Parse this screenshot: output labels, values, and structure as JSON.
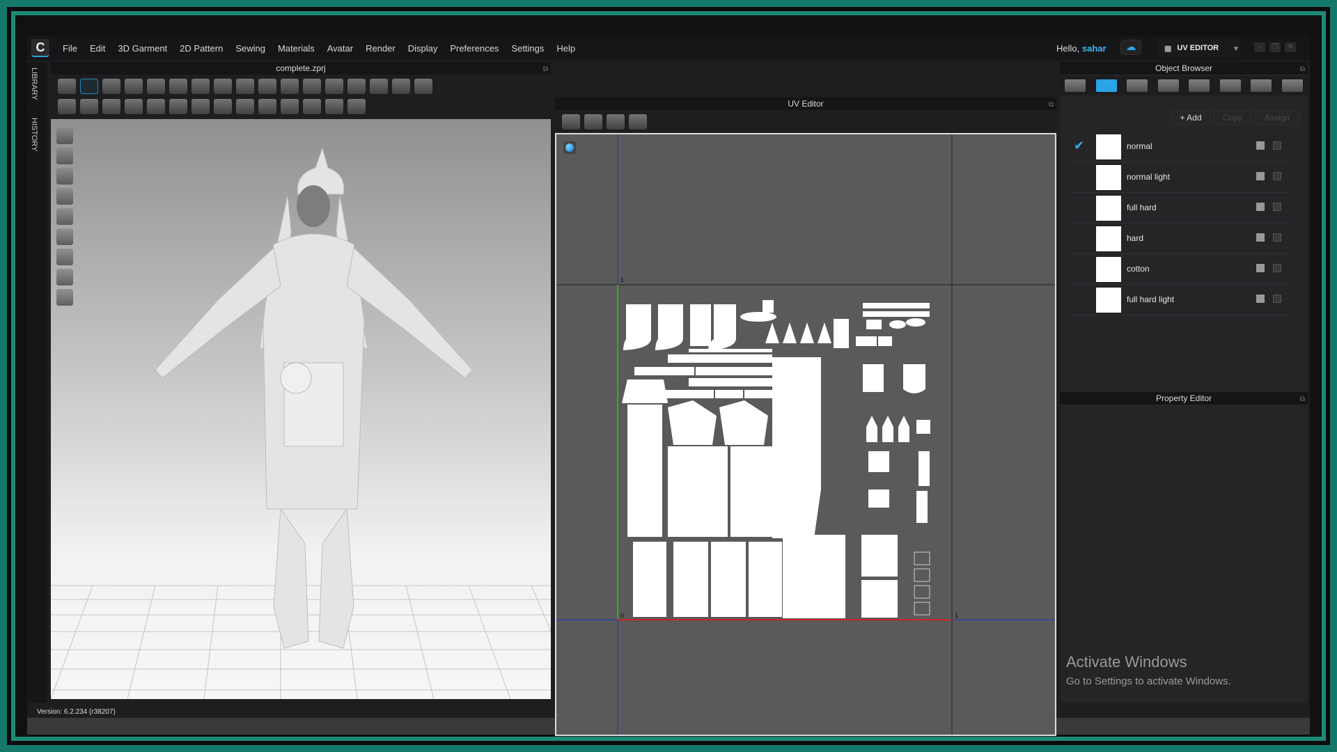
{
  "app": {
    "logo": "C",
    "menu": [
      "File",
      "Edit",
      "3D Garment",
      "2D Pattern",
      "Sewing",
      "Materials",
      "Avatar",
      "Render",
      "Display",
      "Preferences",
      "Settings",
      "Help"
    ],
    "greeting": "Hello,",
    "user": "sahar",
    "mode": "UV EDITOR",
    "mode_icon": "uv-grid-icon"
  },
  "sidebar": {
    "tabs": [
      "LIBRARY",
      "HISTORY"
    ]
  },
  "viewport": {
    "title": "complete.zprj",
    "toolbar_row1": [
      "select-move-icon",
      "transform-pattern-icon",
      "edit-pattern-icon",
      "garment-icon",
      "segment-icon",
      "pin-icon",
      "sewing-icon",
      "free-sewing-icon",
      "fold-icon",
      "brush-icon",
      "simulate-icon",
      "avatar-garment-icon",
      "shirt-icon",
      "pants-icon",
      "tshirt-icon",
      "shirt-seam-icon",
      "shirt-measure-icon"
    ],
    "toolbar_row2": [
      "tape-icon",
      "steam-icon",
      "shrink-icon",
      "graphic-icon",
      "texture-icon",
      "texture-transform-icon",
      "button-icon",
      "buttonhole-icon",
      "zipper-icon",
      "zipper-edit-icon",
      "puckering-icon",
      "topstitch-icon",
      "topstitch-edit-icon",
      "measure-icon"
    ],
    "side_tools": [
      "avatar-view-icon",
      "garment-view-icon",
      "texture-view-icon",
      "mesh-view-icon",
      "pattern-view-icon",
      "uv-view-icon",
      "shading-icon",
      "skin-icon",
      "globe-icon"
    ]
  },
  "uv_editor": {
    "title": "UV Editor",
    "toolbar": [
      "snapshot-icon",
      "camera-icon",
      "move-uv-icon",
      "scale-uv-icon"
    ],
    "tick_top": "1",
    "tick_origin": "0",
    "tick_right": "1"
  },
  "object_browser": {
    "title": "Object Browser",
    "tabs": [
      "list-icon",
      "fabric-icon",
      "button-icon",
      "tape-icon",
      "topstitch-icon",
      "puckering-icon",
      "graphic-icon",
      "ruler-icon"
    ],
    "add": "+ Add",
    "copy": "Copy",
    "assign": "Assign",
    "fabrics": [
      {
        "name": "normal",
        "selected": true
      },
      {
        "name": "normal light",
        "selected": false
      },
      {
        "name": "full hard",
        "selected": false
      },
      {
        "name": "hard",
        "selected": false
      },
      {
        "name": "cotton",
        "selected": false
      },
      {
        "name": "full hard light",
        "selected": false
      }
    ]
  },
  "property_editor": {
    "title": "Property Editor"
  },
  "watermark": {
    "title": "Activate Windows",
    "subtitle": "Go to Settings to activate Windows."
  },
  "status": {
    "version": "Version: 6.2.234 (r38207)"
  },
  "colors": {
    "accent": "#2aa3e8",
    "frame": "#1d8a78"
  }
}
